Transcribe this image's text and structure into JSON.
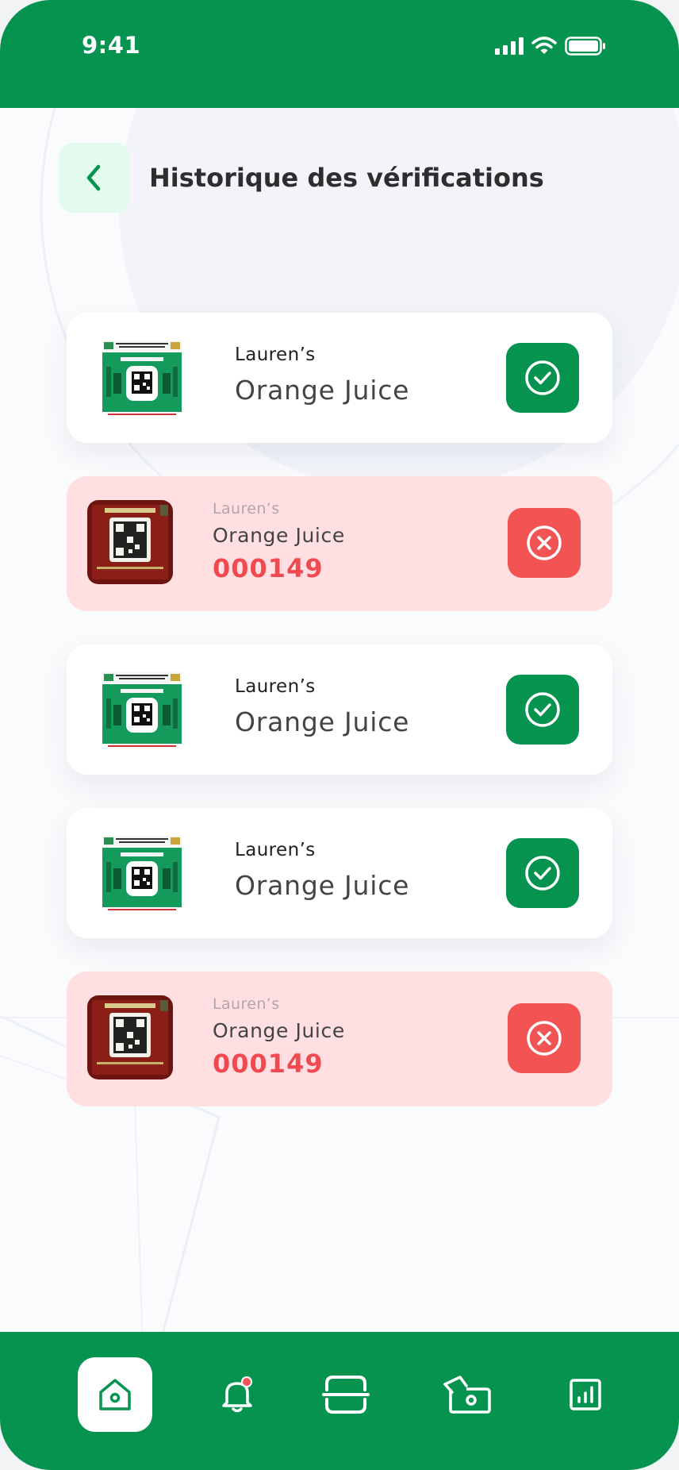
{
  "status_bar": {
    "time": "9:41"
  },
  "header": {
    "title": "Historique des vérifications",
    "back_icon": "chevron-left-icon"
  },
  "colors": {
    "primary": "#06934f",
    "danger": "#f25353",
    "danger_text": "#f04a50",
    "danger_bg": "#ffdfe1"
  },
  "verifications": [
    {
      "status": "valid",
      "brand": "Lauren’s",
      "product": "Orange Juice"
    },
    {
      "status": "invalid",
      "brand": "Lauren’s",
      "product": "Orange Juice",
      "code": "000149"
    },
    {
      "status": "valid",
      "brand": "Lauren’s",
      "product": "Orange Juice"
    },
    {
      "status": "valid",
      "brand": "Lauren’s",
      "product": "Orange Juice"
    },
    {
      "status": "invalid",
      "brand": "Lauren’s",
      "product": "Orange Juice",
      "code": "000149"
    }
  ],
  "nav": [
    {
      "icon": "home-icon",
      "active": true
    },
    {
      "icon": "bell-icon",
      "active": false,
      "badge": true
    },
    {
      "icon": "scan-icon",
      "active": false
    },
    {
      "icon": "payment-icon",
      "active": false
    },
    {
      "icon": "stats-icon",
      "active": false
    }
  ]
}
